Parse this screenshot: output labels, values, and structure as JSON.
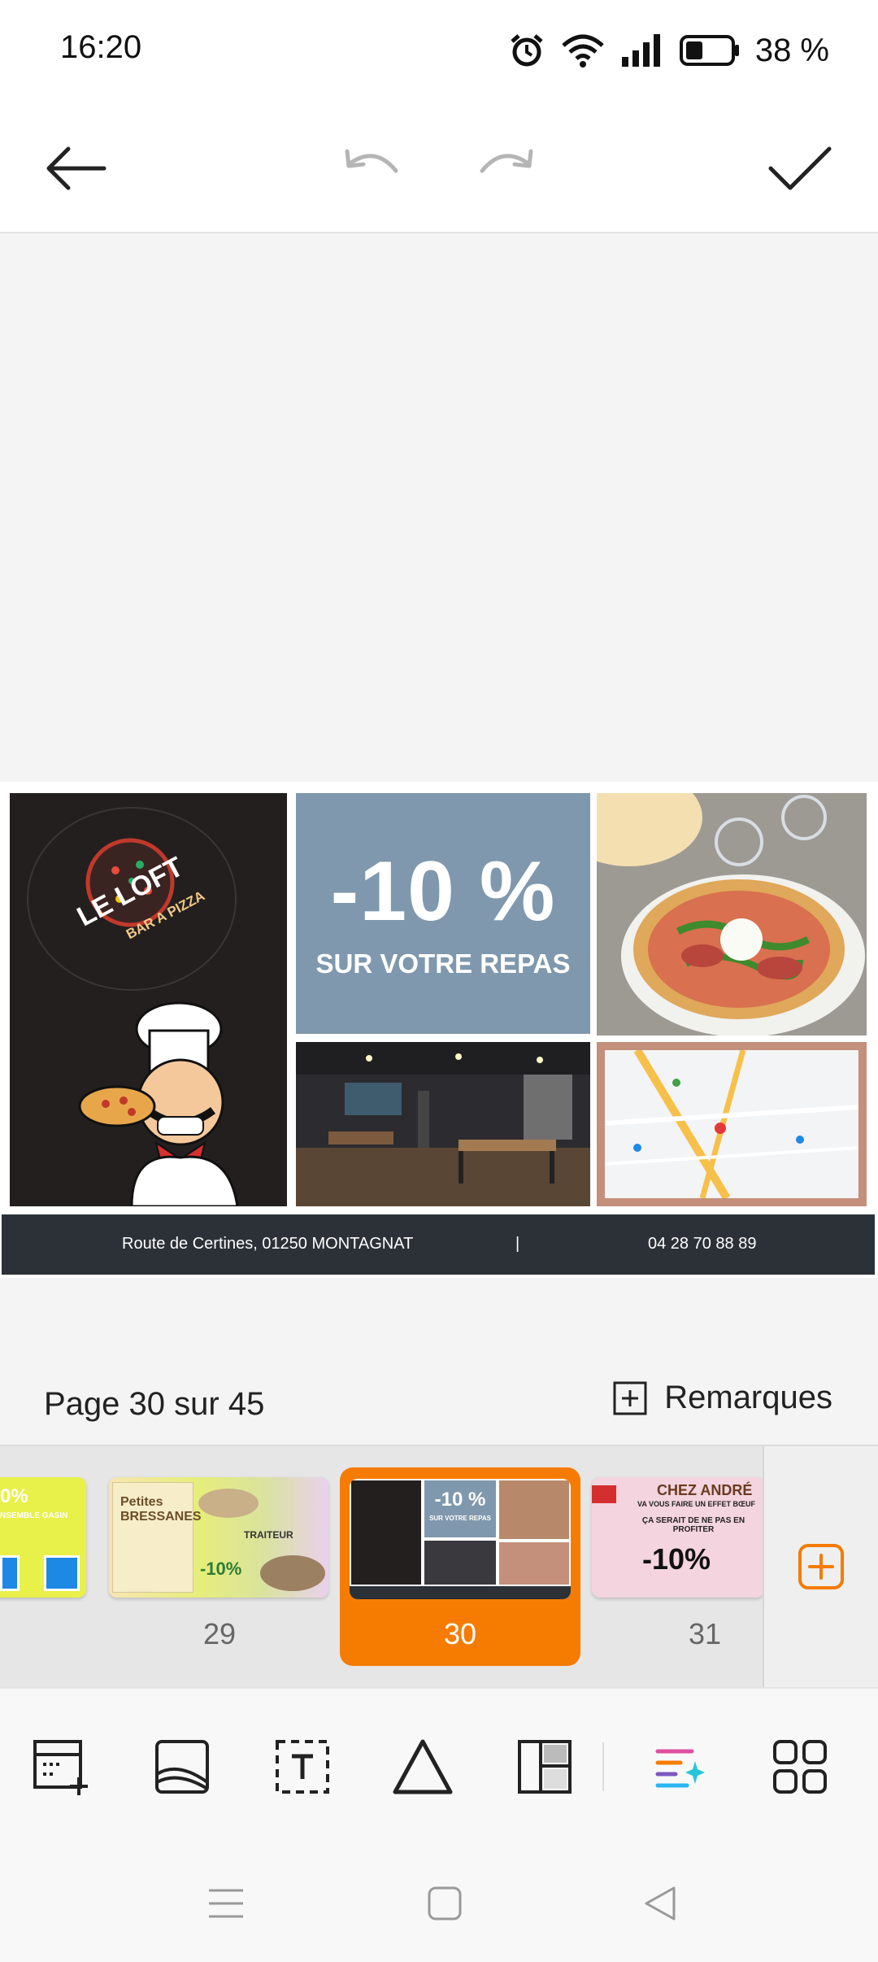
{
  "status_bar": {
    "time": "16:20",
    "battery_percent": "38 %",
    "icons": [
      "alarm-icon",
      "wifi-icon",
      "signal-icon",
      "battery-icon"
    ]
  },
  "toolbar": {
    "back_icon": "arrow-left-icon",
    "undo_icon": "undo-icon",
    "redo_icon": "redo-icon",
    "confirm_icon": "checkmark-icon"
  },
  "flyer": {
    "logo_text": "LE LOFT",
    "logo_subtext": "BAR A PIZZA",
    "promo_value": "-10 %",
    "promo_text": "SUR VOTRE REPAS",
    "address": "Route de Certines, 01250 MONTAGNAT",
    "separator": "|",
    "phone": "04 28 70 88 89"
  },
  "pagination": {
    "label": "Page 30 sur 45",
    "remarks_label": "Remarques"
  },
  "thumbnails": [
    {
      "page": "29",
      "title": "Petites BRESSANES",
      "detail": "TRAITEUR",
      "discount": "-10%"
    },
    {
      "page": "30",
      "selected": true,
      "promo": "-10 %",
      "promo_text": "SUR VOTRE REPAS"
    },
    {
      "page": "31",
      "title": "CHEZ ANDRÉ",
      "line1": "VA VOUS FAIRE UN EFFET BŒUF",
      "line2": "ÇA SERAIT DE NE PAS EN PROFITER",
      "discount": "-10%"
    }
  ],
  "thumb_partial": {
    "discount": "0%",
    "line": "NSEMBLE GASIN"
  },
  "tools": [
    "add-page-icon",
    "image-icon",
    "text-box-icon",
    "shape-icon",
    "layout-icon",
    "ai-magic-icon",
    "grid-icon"
  ],
  "nav": [
    "menu-icon",
    "home-icon",
    "back-triangle-icon"
  ],
  "colors": {
    "accent": "#f57c00",
    "promo_panel": "#7f98ad",
    "footer_band": "#2c3138"
  }
}
